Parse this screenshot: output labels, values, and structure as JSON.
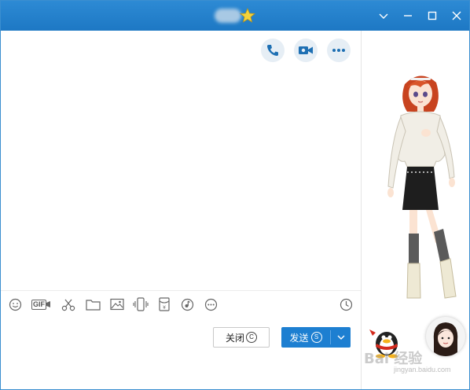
{
  "window": {
    "title_badge_icon": "star-icon",
    "controls": [
      "chevron-down-icon",
      "minimize-icon",
      "maximize-icon",
      "close-icon"
    ]
  },
  "header_actions": [
    "phone-icon",
    "video-camera-icon",
    "more-icon"
  ],
  "toolbar": {
    "tools": [
      "emoji-icon",
      "gif-icon",
      "scissors-icon",
      "folder-icon",
      "image-icon",
      "shake-icon",
      "red-packet-icon",
      "music-icon",
      "more-icon"
    ],
    "gif_label": "GIF",
    "history_icon": "clock-icon"
  },
  "buttons": {
    "close_label": "关闭",
    "close_shortcut": "C",
    "send_label": "发送",
    "send_shortcut": "S"
  },
  "watermark": {
    "text": "Bai 经验",
    "sub": "jingyan.baidu.com"
  },
  "colors": {
    "titlebar": "#1d78c4",
    "send_button": "#1d7fd1",
    "action_circle": "#e6eef5",
    "icon": "#666666"
  }
}
